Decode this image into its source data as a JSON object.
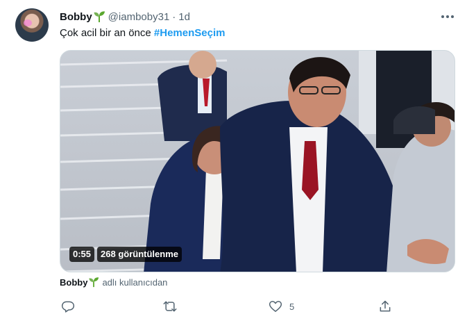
{
  "tweet": {
    "author_name": "Bobby",
    "handle": "@iamboby31",
    "separator": "·",
    "time": "1d",
    "text": "Çok acil bir an önce ",
    "hashtag": "#HemenSeçim"
  },
  "video": {
    "duration": "0:55",
    "views": "268 görüntülenme"
  },
  "attribution": {
    "name": "Bobby",
    "text": "adlı kullanıcıdan"
  },
  "actions": {
    "reply_count": "",
    "retweet_count": "",
    "like_count": "5",
    "share_count": ""
  },
  "icons": {
    "sprout": "seedling-emoji",
    "more": "more-horizontal-icon",
    "reply": "reply-icon",
    "retweet": "retweet-icon",
    "like": "heart-icon",
    "share": "share-icon"
  },
  "colors": {
    "accent": "#1d9bf0",
    "secondary_text": "#536471",
    "primary_text": "#0f1419",
    "sprout": "#5ba82f"
  }
}
